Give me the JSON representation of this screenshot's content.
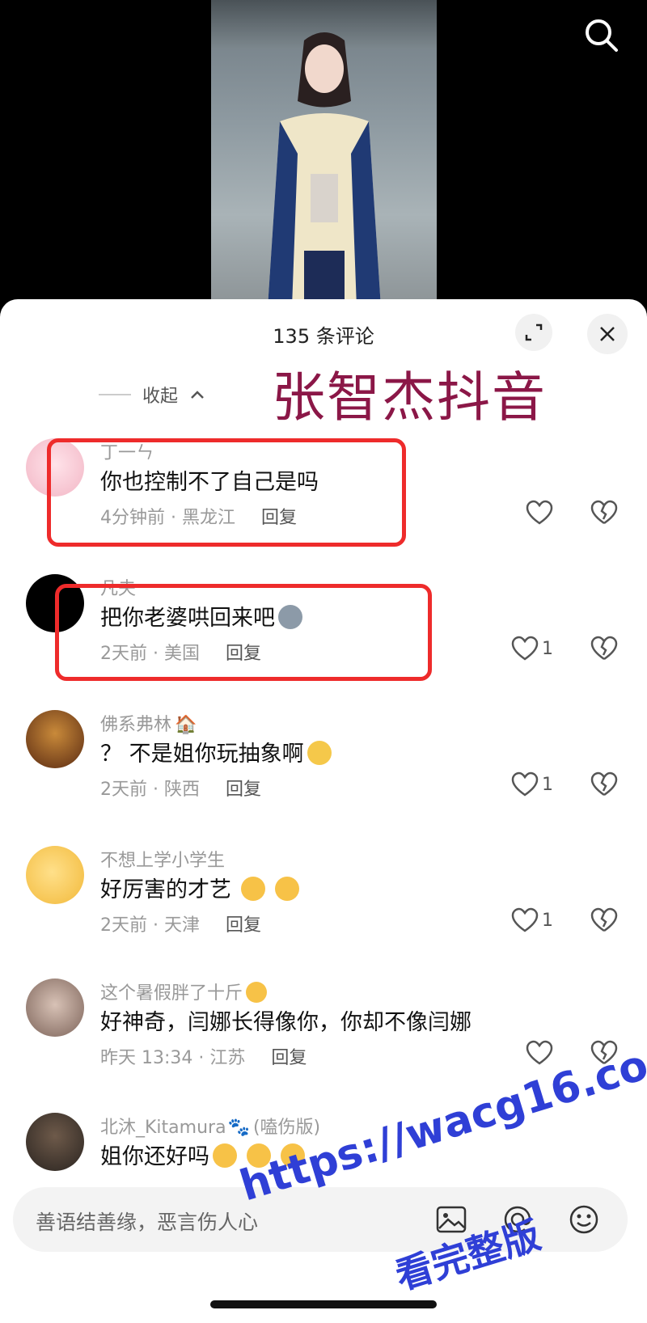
{
  "sheet": {
    "title": "135 条评论",
    "collapse_label": "收起"
  },
  "overlay_title": "张智杰抖音",
  "comments": [
    {
      "username": "丁一ㄣ",
      "text": "你也控制不了自己是吗",
      "time_location": "4分钟前 · 黑龙江",
      "reply": "回复",
      "likes": "",
      "emoji": ""
    },
    {
      "username": "凡夫",
      "text": "把你老婆哄回来吧",
      "time_location": "2天前 · 美国",
      "reply": "回复",
      "likes": "1",
      "emoji": "husky-face"
    },
    {
      "username": "佛系弗林",
      "text": "？ 不是姐你玩抽象啊",
      "time_location": "2天前 · 陕西",
      "reply": "回复",
      "likes": "1",
      "emoji": "rolling-laughing"
    },
    {
      "username": "不想上学小学生",
      "text": "好厉害的才艺",
      "time_location": "2天前 · 天津",
      "reply": "回复",
      "likes": "1",
      "emoji": "finger-heart"
    },
    {
      "username": "这个暑假胖了十斤",
      "text": "好神奇，闫娜长得像你，你却不像闫娜",
      "time_location": "昨天 13:34 · 江苏",
      "reply": "回复",
      "likes": "",
      "emoji": ""
    },
    {
      "username": "北沐_Kitamura",
      "username_suffix": "(嗑伤版)",
      "text": "姐你还好吗",
      "time_location": "",
      "reply": "",
      "likes": "",
      "emoji": "pleading-face"
    }
  ],
  "input": {
    "placeholder": "善语结善缘，恶言伤人心"
  },
  "watermark": {
    "line1": "https://wacg16.com",
    "line2": "看完整版"
  },
  "colors": {
    "highlight_box": "#ee2b2b",
    "overlay_title": "#8b1747",
    "watermark": "#2f3fd6"
  }
}
